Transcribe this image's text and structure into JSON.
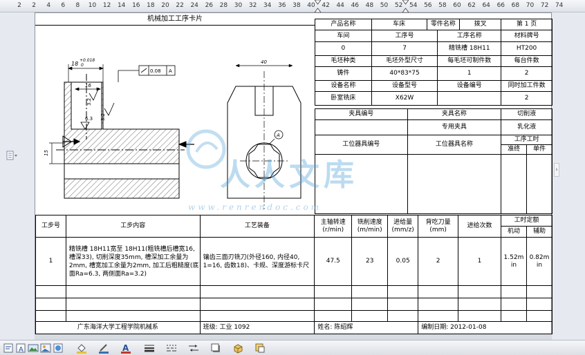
{
  "ruler": {
    "numbers": [
      "2",
      "2",
      "4",
      "6",
      "8",
      "10",
      "12",
      "14",
      "16",
      "18",
      "20",
      "22",
      "24",
      "26",
      "28",
      "30",
      "32",
      "34",
      "36",
      "38",
      "40",
      "42",
      "44",
      "46",
      "48",
      "50",
      "52",
      "54",
      "56",
      "58",
      "60",
      "62",
      "64",
      "66",
      "68",
      "70",
      "72",
      "74"
    ]
  },
  "card": {
    "title": "机械加工工序卡片",
    "header_rows": [
      [
        "产品名称",
        "车床",
        "零件名称",
        "拨叉",
        "第  1  页"
      ],
      [
        "车间",
        "工序号",
        "工序名称",
        "材料牌号"
      ],
      [
        "0",
        "7",
        "精铣槽 18H11",
        "HT200"
      ],
      [
        "毛坯种类",
        "毛坯外型尺寸",
        "每毛坯可制件数",
        "每台件数"
      ],
      [
        "铸件",
        "40*83*75",
        "1",
        "2"
      ],
      [
        "设备名称",
        "设备型号",
        "设备编号",
        "同时加工件数"
      ],
      [
        "卧室铣床",
        "X62W",
        "",
        "2"
      ]
    ],
    "fixture": {
      "fixture_no_label": "夹具编号",
      "fixture_name_label": "夹具名称",
      "coolant_label": "切削液",
      "fixture_name": "专用夹具",
      "coolant": "乳化液",
      "station_tool_no_label": "工位器具编号",
      "station_tool_name_label": "工位器具名称",
      "work_time_label": "工序工时",
      "prep_label": "准终",
      "unit_label": "单件"
    },
    "steps_header": {
      "step_no": "工步号",
      "content": "工步内容",
      "equipment": "工艺装备",
      "spindle": "主轴转速\n(r/min)",
      "cut_speed": "铣削速度\n(m/min)",
      "feed": "进给量\n(mm/z)",
      "depth": "背吃刀量\n(mm)",
      "passes": "进给次数",
      "time_quota": "工时定额",
      "machine": "机动",
      "aux": "辅助"
    },
    "step1": {
      "no": "1",
      "content": "精铣槽 18H11宽至 18H11(粗铣槽后槽宽16, 槽深33), 切削深度35mm, 槽深加工余量为2mm, 槽宽加工余量为2mm, 加工后粗糙度(底面Ra=6.3, 两侧面Ra=3.2)",
      "equipment": "镶齿三面刃铣刀(外径160, 内径40, 1=16, 齿数18)、卡规、深度游标卡尺",
      "spindle": "47.5",
      "cut_speed": "23",
      "feed": "0.05",
      "depth": "2",
      "passes": "1",
      "machine": "1.52m\nin",
      "aux": "0.82m\nin"
    },
    "footer": {
      "school": "广东海洋大学工程学院机械系",
      "class": "班级: 工业 1092",
      "name": "姓名: 陈绍辉",
      "date": "编制日期: 2012-01-08"
    },
    "drawing_labels": {
      "dim_top": "18",
      "tol_upper": "+0.018",
      "tol_lower": "0",
      "tol_box_value": "0.08",
      "tol_box_ref": "A",
      "dim_16": "16",
      "rough_32a": "3.2",
      "rough_32b": "3.2",
      "rough_63": "6.3",
      "dim_15": "15",
      "dim_40": "40",
      "datum_a": "A"
    }
  },
  "watermark": {
    "text": "人人文库",
    "url": "www.renrendoc.com"
  },
  "colors": {
    "page_bg": "#ffffff",
    "chrome_bg": "#e6e9ef",
    "watermark": "#4fa0d8"
  }
}
